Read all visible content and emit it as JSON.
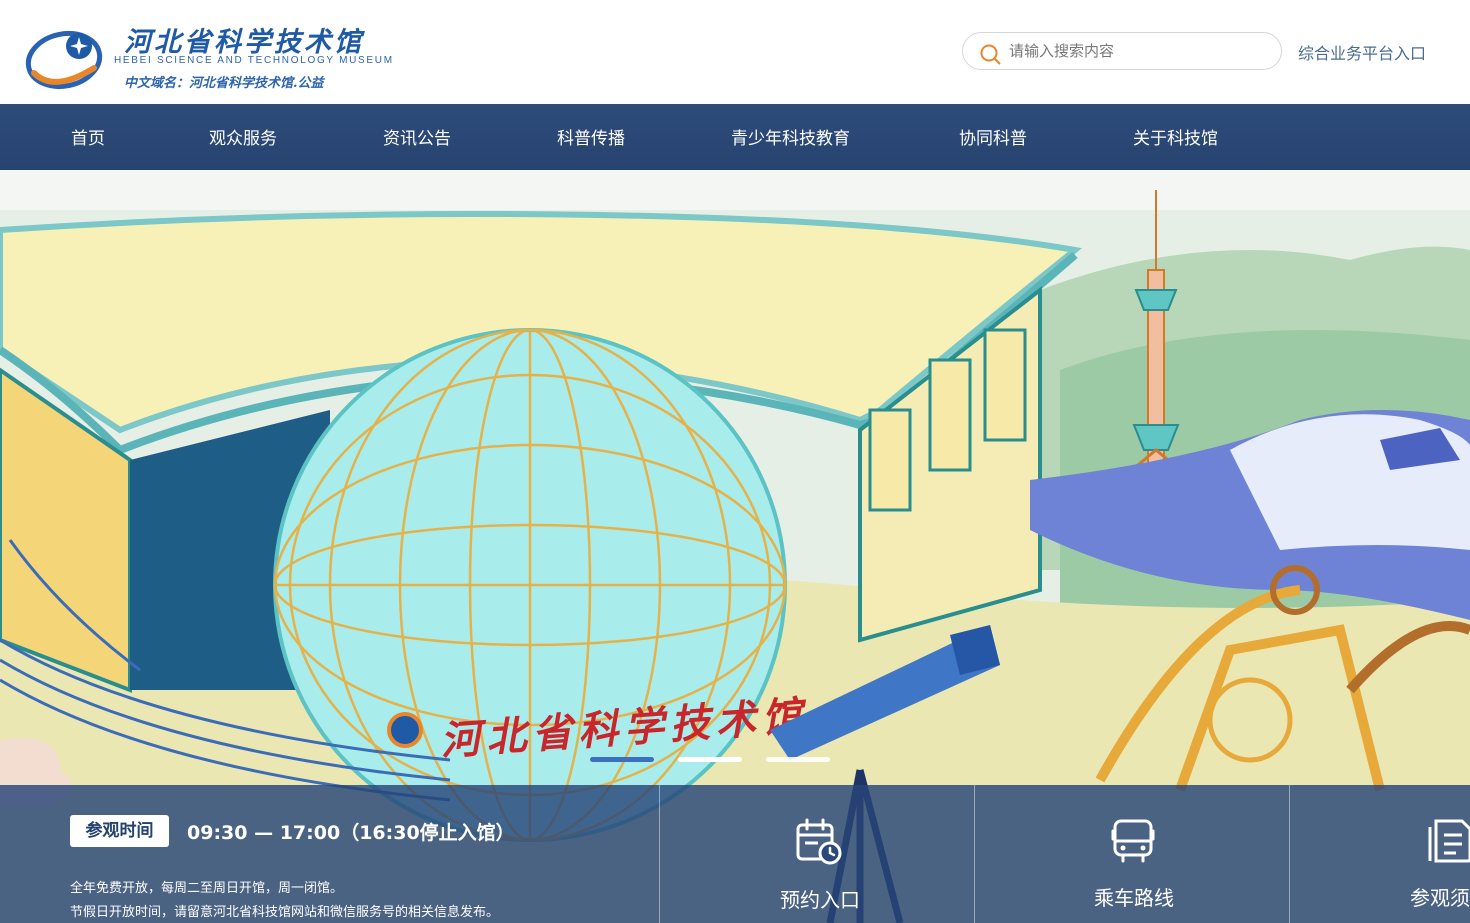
{
  "header": {
    "logo": {
      "name_cn": "河北省科学技术馆",
      "name_en": "HEBEI SCIENCE AND TECHNOLOGY MUSEUM",
      "domain": "中文域名：河北省科学技术馆.公益"
    },
    "search": {
      "placeholder": "请输入搜索内容",
      "icon": "search-icon"
    },
    "platform_link": "综合业务平台入口"
  },
  "nav": {
    "items": [
      {
        "label": "首页"
      },
      {
        "label": "观众服务"
      },
      {
        "label": "资讯公告"
      },
      {
        "label": "科普传播"
      },
      {
        "label": "青少年科技教育"
      },
      {
        "label": "协同科普"
      },
      {
        "label": "关于科技馆"
      }
    ]
  },
  "banner": {
    "sign_text": "河北省科学技术馆",
    "slides_total": 3,
    "active_slide": 2
  },
  "info": {
    "visit_badge": "参观时间",
    "visit_time": "09:30 — 17:00（16:30停止入馆）",
    "note1": "全年免费开放，每周二至周日开馆，周一闭馆。",
    "note2": "节假日开放时间，请留意河北省科技馆网站和微信服务号的相关信息发布。"
  },
  "quick_links": [
    {
      "label": "预约入口",
      "icon": "calendar-clock-icon"
    },
    {
      "label": "乘车路线",
      "icon": "bus-icon"
    },
    {
      "label": "参观须",
      "icon": "document-icon"
    }
  ],
  "colors": {
    "nav_bg": "#2c4a76",
    "infobar_bg": "#284678",
    "accent_orange": "#e8862a",
    "logo_blue": "#1f5aa6"
  }
}
